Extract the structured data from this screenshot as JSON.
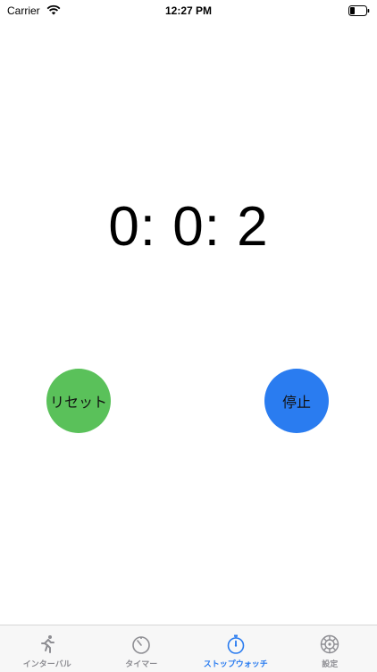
{
  "status_bar": {
    "carrier": "Carrier",
    "time": "12:27 PM"
  },
  "timer": {
    "display": "0: 0: 2"
  },
  "buttons": {
    "reset_label": "リセット",
    "stop_label": "停止"
  },
  "tab_bar": {
    "tabs": [
      {
        "label": "インターバル",
        "icon": "runner-icon",
        "active": false
      },
      {
        "label": "タイマー",
        "icon": "timer-icon",
        "active": false
      },
      {
        "label": "ストップウォッチ",
        "icon": "stopwatch-icon",
        "active": true
      },
      {
        "label": "設定",
        "icon": "gear-icon",
        "active": false
      }
    ]
  },
  "colors": {
    "reset_button": "#5ac15a",
    "stop_button": "#2a7cf0",
    "active_tab": "#2a7cf0",
    "inactive_tab": "#8e8e93"
  }
}
